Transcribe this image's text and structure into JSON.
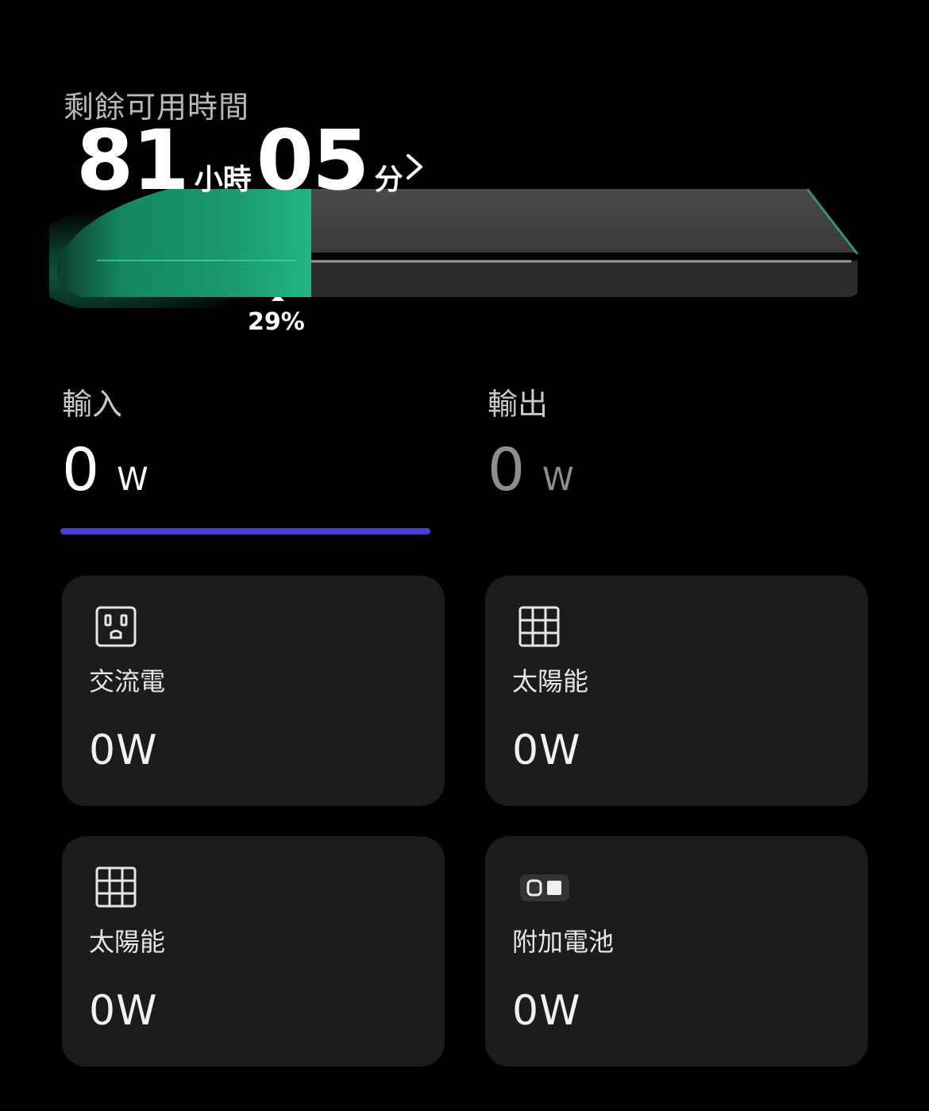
{
  "battery": {
    "remaining_label": "剩餘可用時間",
    "hours": "81",
    "hours_unit": "小時",
    "minutes": "05",
    "minutes_unit": "分",
    "level_percent_text": "29%",
    "level_fraction": 0.29,
    "fill_color": "#1fa77a",
    "empty_color": "#3a3a3a"
  },
  "tabs": {
    "input": {
      "label": "輸入",
      "value": "0",
      "unit": "W",
      "active": true
    },
    "output": {
      "label": "輸出",
      "value": "0",
      "unit": "W",
      "active": false
    },
    "indicator_color": "#4b3fd6"
  },
  "sources": [
    {
      "icon": "ac-outlet-icon",
      "label": "交流電",
      "value": "0W"
    },
    {
      "icon": "solar-panel-icon",
      "label": "太陽能",
      "value": "0W"
    },
    {
      "icon": "solar-panel-icon",
      "label": "太陽能",
      "value": "0W"
    },
    {
      "icon": "extra-battery-icon",
      "label": "附加電池",
      "value": "0W"
    }
  ]
}
